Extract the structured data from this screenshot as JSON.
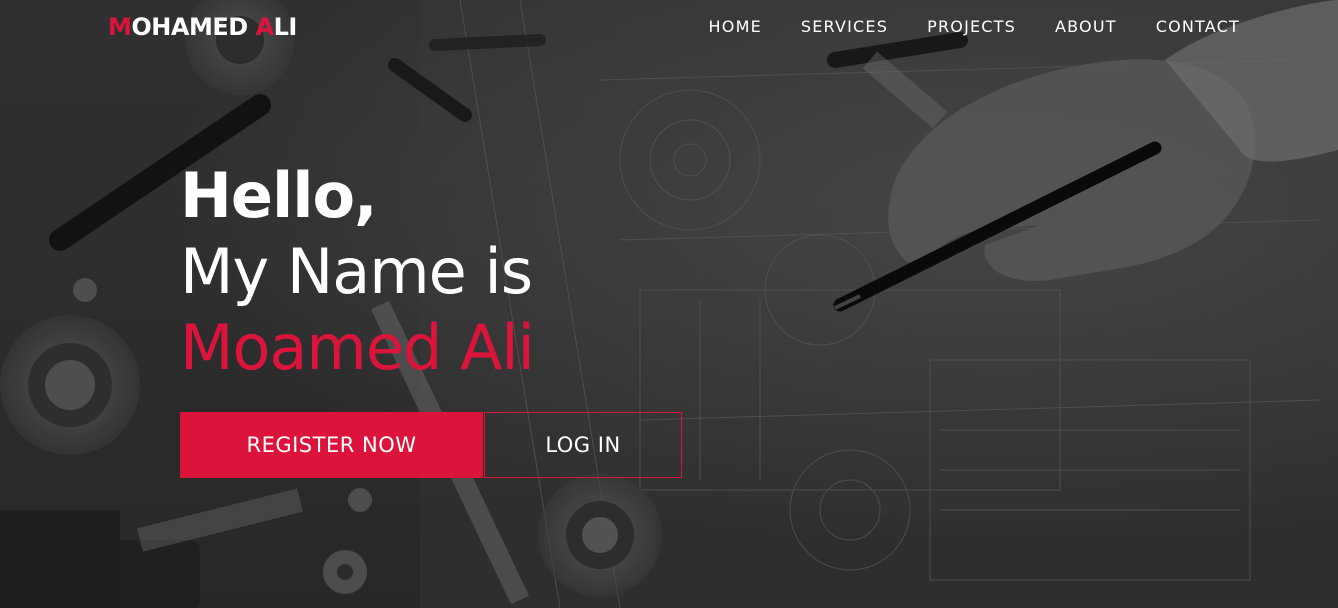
{
  "brand": {
    "first_initial": "M",
    "first_rest": "OHAMED ",
    "last_initial": "A",
    "last_rest": "LI",
    "accent_color": "#dc143c"
  },
  "nav": {
    "items": [
      {
        "label": "HOME"
      },
      {
        "label": "SERVICES"
      },
      {
        "label": "PROJECTS"
      },
      {
        "label": "ABOUT"
      },
      {
        "label": "CONTACT"
      }
    ]
  },
  "hero": {
    "line1": "Hello,",
    "line2": "My Name is",
    "line3": "Moamed Ali"
  },
  "actions": {
    "register_label": "REGISTER NOW",
    "login_label": "LOG IN"
  }
}
